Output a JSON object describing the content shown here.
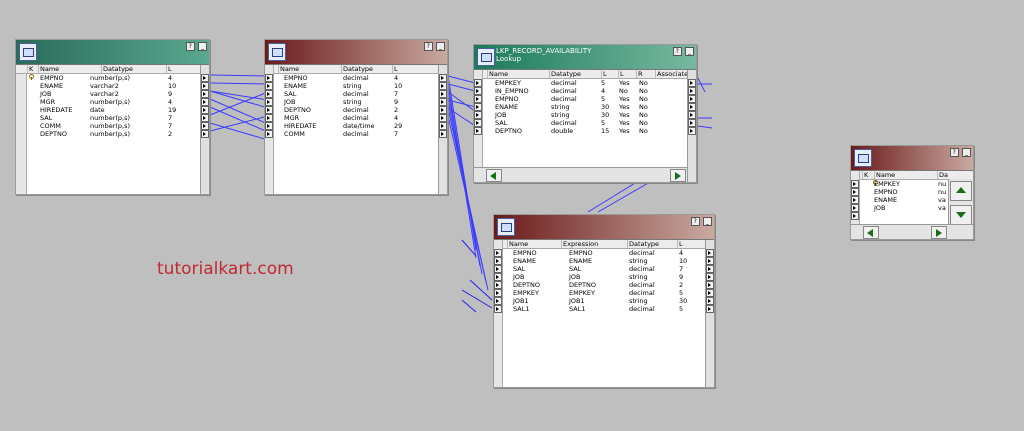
{
  "watermark": "tutorialkart.com",
  "source": {
    "columns": [
      "K",
      "Name",
      "Datatype",
      "L"
    ],
    "rows": [
      {
        "key": true,
        "name": "EMPNO",
        "type": "number(p,s)",
        "len": "4"
      },
      {
        "key": false,
        "name": "ENAME",
        "type": "varchar2",
        "len": "10"
      },
      {
        "key": false,
        "name": "JOB",
        "type": "varchar2",
        "len": "9"
      },
      {
        "key": false,
        "name": "MGR",
        "type": "number(p,s)",
        "len": "4"
      },
      {
        "key": false,
        "name": "HIREDATE",
        "type": "date",
        "len": "19"
      },
      {
        "key": false,
        "name": "SAL",
        "type": "number(p,s)",
        "len": "7"
      },
      {
        "key": false,
        "name": "COMM",
        "type": "number(p,s)",
        "len": "7"
      },
      {
        "key": false,
        "name": "DEPTNO",
        "type": "number(p,s)",
        "len": "2"
      }
    ]
  },
  "sq": {
    "columns": [
      "Name",
      "Datatype",
      "L"
    ],
    "rows": [
      {
        "name": "EMPNO",
        "type": "decimal",
        "len": "4"
      },
      {
        "name": "ENAME",
        "type": "string",
        "len": "10"
      },
      {
        "name": "SAL",
        "type": "decimal",
        "len": "7"
      },
      {
        "name": "JOB",
        "type": "string",
        "len": "9"
      },
      {
        "name": "DEPTNO",
        "type": "decimal",
        "len": "2"
      },
      {
        "name": "MGR",
        "type": "decimal",
        "len": "4"
      },
      {
        "name": "HIREDATE",
        "type": "date/time",
        "len": "29"
      },
      {
        "name": "COMM",
        "type": "decimal",
        "len": "7"
      }
    ]
  },
  "lookup": {
    "title1": "LKP_RECORD_AVAILABILITY",
    "title2": "Lookup",
    "columns": [
      "Name",
      "Datatype",
      "L",
      "L",
      "R",
      "Associate"
    ],
    "rows": [
      {
        "name": "EMPKEY",
        "type": "decimal",
        "len": "5",
        "lk": "Yes",
        "r": "No"
      },
      {
        "name": "IN_EMPNO",
        "type": "decimal",
        "len": "4",
        "lk": "No",
        "r": "No"
      },
      {
        "name": "EMPNO",
        "type": "decimal",
        "len": "5",
        "lk": "Yes",
        "r": "No"
      },
      {
        "name": "ENAME",
        "type": "string",
        "len": "30",
        "lk": "Yes",
        "r": "No"
      },
      {
        "name": "JOB",
        "type": "string",
        "len": "30",
        "lk": "Yes",
        "r": "No"
      },
      {
        "name": "SAL",
        "type": "decimal",
        "len": "5",
        "lk": "Yes",
        "r": "No"
      },
      {
        "name": "DEPTNO",
        "type": "double",
        "len": "15",
        "lk": "Yes",
        "r": "No"
      }
    ]
  },
  "expr": {
    "columns": [
      "Name",
      "Expression",
      "Datatype",
      "L"
    ],
    "rows": [
      {
        "name": "EMPNO",
        "expr": "EMPNO",
        "type": "decimal",
        "len": "4"
      },
      {
        "name": "ENAME",
        "expr": "ENAME",
        "type": "string",
        "len": "10"
      },
      {
        "name": "SAL",
        "expr": "SAL",
        "type": "decimal",
        "len": "7"
      },
      {
        "name": "JOB",
        "expr": "JOB",
        "type": "string",
        "len": "9"
      },
      {
        "name": "DEPTNO",
        "expr": "DEPTNO",
        "type": "decimal",
        "len": "2"
      },
      {
        "name": "EMPKEY",
        "expr": "EMPKEY",
        "type": "decimal",
        "len": "5"
      },
      {
        "name": "JOB1",
        "expr": "JOB1",
        "type": "string",
        "len": "30"
      },
      {
        "name": "SAL1",
        "expr": "SAL1",
        "type": "decimal",
        "len": "5"
      }
    ]
  },
  "target": {
    "columns": [
      "K",
      "Name",
      "Da"
    ],
    "rows": [
      {
        "key": true,
        "name": "EMPKEY",
        "type": "nu"
      },
      {
        "key": false,
        "name": "EMPNO",
        "type": "nu"
      },
      {
        "key": false,
        "name": "ENAME",
        "type": "va"
      },
      {
        "key": false,
        "name": "JOB",
        "type": "va"
      }
    ]
  },
  "window_buttons": {
    "help": "?",
    "minimize": "_"
  },
  "colors": {
    "canvas": "#bfbfbf",
    "link": "#3c3cff",
    "watermark": "#c0292e"
  }
}
